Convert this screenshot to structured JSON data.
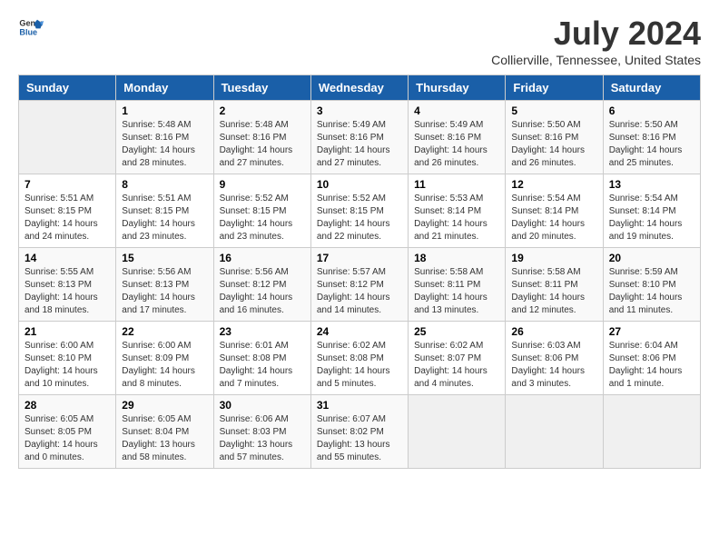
{
  "header": {
    "logo_line1": "General",
    "logo_line2": "Blue",
    "month": "July 2024",
    "location": "Collierville, Tennessee, United States"
  },
  "weekdays": [
    "Sunday",
    "Monday",
    "Tuesday",
    "Wednesday",
    "Thursday",
    "Friday",
    "Saturday"
  ],
  "weeks": [
    [
      {
        "day": "",
        "info": ""
      },
      {
        "day": "1",
        "info": "Sunrise: 5:48 AM\nSunset: 8:16 PM\nDaylight: 14 hours\nand 28 minutes."
      },
      {
        "day": "2",
        "info": "Sunrise: 5:48 AM\nSunset: 8:16 PM\nDaylight: 14 hours\nand 27 minutes."
      },
      {
        "day": "3",
        "info": "Sunrise: 5:49 AM\nSunset: 8:16 PM\nDaylight: 14 hours\nand 27 minutes."
      },
      {
        "day": "4",
        "info": "Sunrise: 5:49 AM\nSunset: 8:16 PM\nDaylight: 14 hours\nand 26 minutes."
      },
      {
        "day": "5",
        "info": "Sunrise: 5:50 AM\nSunset: 8:16 PM\nDaylight: 14 hours\nand 26 minutes."
      },
      {
        "day": "6",
        "info": "Sunrise: 5:50 AM\nSunset: 8:16 PM\nDaylight: 14 hours\nand 25 minutes."
      }
    ],
    [
      {
        "day": "7",
        "info": "Sunrise: 5:51 AM\nSunset: 8:15 PM\nDaylight: 14 hours\nand 24 minutes."
      },
      {
        "day": "8",
        "info": "Sunrise: 5:51 AM\nSunset: 8:15 PM\nDaylight: 14 hours\nand 23 minutes."
      },
      {
        "day": "9",
        "info": "Sunrise: 5:52 AM\nSunset: 8:15 PM\nDaylight: 14 hours\nand 23 minutes."
      },
      {
        "day": "10",
        "info": "Sunrise: 5:52 AM\nSunset: 8:15 PM\nDaylight: 14 hours\nand 22 minutes."
      },
      {
        "day": "11",
        "info": "Sunrise: 5:53 AM\nSunset: 8:14 PM\nDaylight: 14 hours\nand 21 minutes."
      },
      {
        "day": "12",
        "info": "Sunrise: 5:54 AM\nSunset: 8:14 PM\nDaylight: 14 hours\nand 20 minutes."
      },
      {
        "day": "13",
        "info": "Sunrise: 5:54 AM\nSunset: 8:14 PM\nDaylight: 14 hours\nand 19 minutes."
      }
    ],
    [
      {
        "day": "14",
        "info": "Sunrise: 5:55 AM\nSunset: 8:13 PM\nDaylight: 14 hours\nand 18 minutes."
      },
      {
        "day": "15",
        "info": "Sunrise: 5:56 AM\nSunset: 8:13 PM\nDaylight: 14 hours\nand 17 minutes."
      },
      {
        "day": "16",
        "info": "Sunrise: 5:56 AM\nSunset: 8:12 PM\nDaylight: 14 hours\nand 16 minutes."
      },
      {
        "day": "17",
        "info": "Sunrise: 5:57 AM\nSunset: 8:12 PM\nDaylight: 14 hours\nand 14 minutes."
      },
      {
        "day": "18",
        "info": "Sunrise: 5:58 AM\nSunset: 8:11 PM\nDaylight: 14 hours\nand 13 minutes."
      },
      {
        "day": "19",
        "info": "Sunrise: 5:58 AM\nSunset: 8:11 PM\nDaylight: 14 hours\nand 12 minutes."
      },
      {
        "day": "20",
        "info": "Sunrise: 5:59 AM\nSunset: 8:10 PM\nDaylight: 14 hours\nand 11 minutes."
      }
    ],
    [
      {
        "day": "21",
        "info": "Sunrise: 6:00 AM\nSunset: 8:10 PM\nDaylight: 14 hours\nand 10 minutes."
      },
      {
        "day": "22",
        "info": "Sunrise: 6:00 AM\nSunset: 8:09 PM\nDaylight: 14 hours\nand 8 minutes."
      },
      {
        "day": "23",
        "info": "Sunrise: 6:01 AM\nSunset: 8:08 PM\nDaylight: 14 hours\nand 7 minutes."
      },
      {
        "day": "24",
        "info": "Sunrise: 6:02 AM\nSunset: 8:08 PM\nDaylight: 14 hours\nand 5 minutes."
      },
      {
        "day": "25",
        "info": "Sunrise: 6:02 AM\nSunset: 8:07 PM\nDaylight: 14 hours\nand 4 minutes."
      },
      {
        "day": "26",
        "info": "Sunrise: 6:03 AM\nSunset: 8:06 PM\nDaylight: 14 hours\nand 3 minutes."
      },
      {
        "day": "27",
        "info": "Sunrise: 6:04 AM\nSunset: 8:06 PM\nDaylight: 14 hours\nand 1 minute."
      }
    ],
    [
      {
        "day": "28",
        "info": "Sunrise: 6:05 AM\nSunset: 8:05 PM\nDaylight: 14 hours\nand 0 minutes."
      },
      {
        "day": "29",
        "info": "Sunrise: 6:05 AM\nSunset: 8:04 PM\nDaylight: 13 hours\nand 58 minutes."
      },
      {
        "day": "30",
        "info": "Sunrise: 6:06 AM\nSunset: 8:03 PM\nDaylight: 13 hours\nand 57 minutes."
      },
      {
        "day": "31",
        "info": "Sunrise: 6:07 AM\nSunset: 8:02 PM\nDaylight: 13 hours\nand 55 minutes."
      },
      {
        "day": "",
        "info": ""
      },
      {
        "day": "",
        "info": ""
      },
      {
        "day": "",
        "info": ""
      }
    ]
  ]
}
